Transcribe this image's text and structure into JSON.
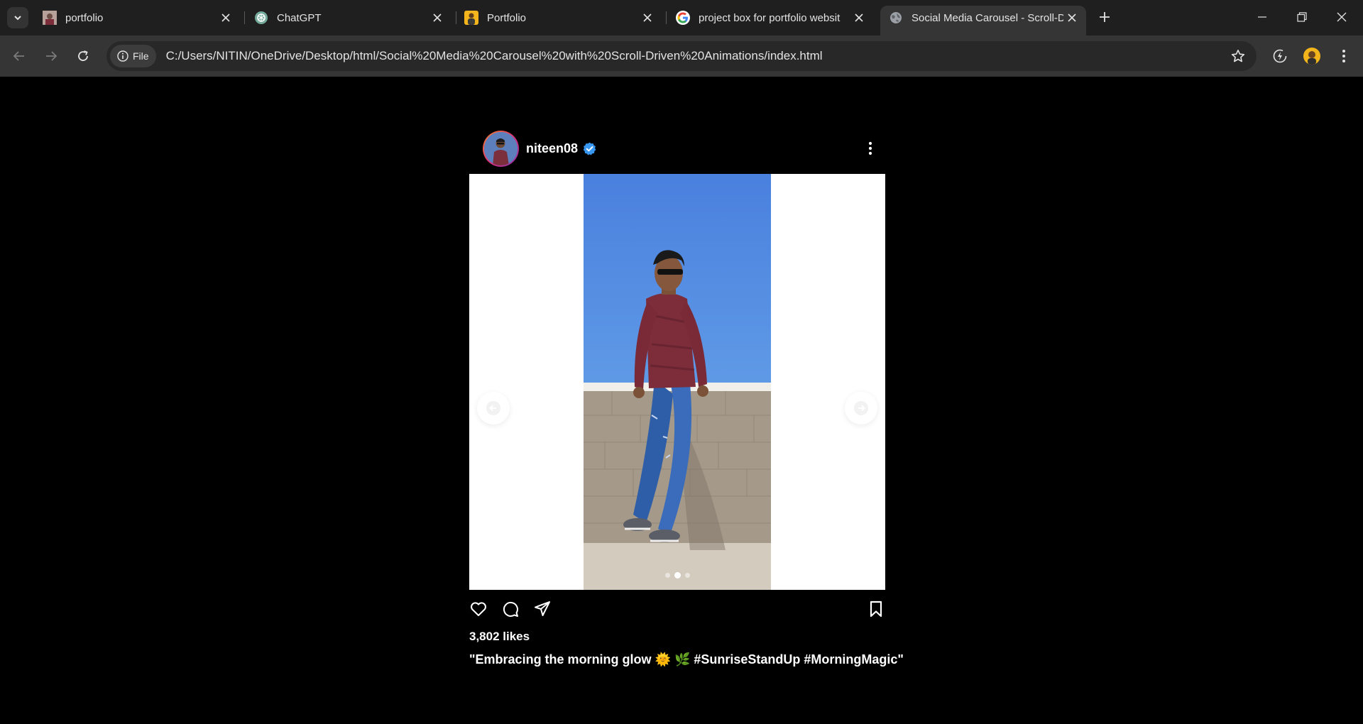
{
  "browser": {
    "tabs": [
      {
        "title": "portfolio",
        "icon": "photo-favicon",
        "active": false
      },
      {
        "title": "ChatGPT",
        "icon": "chatgpt-favicon",
        "active": false
      },
      {
        "title": "Portfolio",
        "icon": "portrait-favicon",
        "active": false
      },
      {
        "title": "project box for portfolio websit",
        "icon": "google-favicon",
        "active": false
      },
      {
        "title": "Social Media Carousel - Scroll-D",
        "icon": "globe-favicon",
        "active": true
      }
    ],
    "chip_label": "File",
    "url": "C:/Users/NITIN/OneDrive/Desktop/html/Social%20Media%20Carousel%20with%20Scroll-Driven%20Animations/index.html"
  },
  "post": {
    "username": "niteen08",
    "verified": true,
    "likes": "3,802 likes",
    "caption": "\"Embracing the morning glow 🌞 🌿 #SunriseStandUp #MorningMagic\"",
    "carousel": {
      "slide_count": 3,
      "active_index": 1
    }
  },
  "colors": {
    "page_bg": "#000000",
    "tabstrip_bg": "#1f1f1f",
    "toolbar_bg": "#353535",
    "verified_badge": "#3897f0",
    "sky": "#4f88dd"
  }
}
